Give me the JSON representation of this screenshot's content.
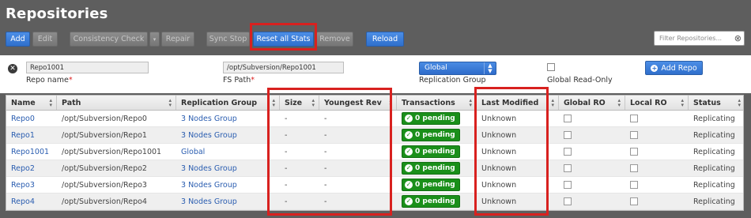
{
  "page": {
    "title": "Repositories"
  },
  "toolbar": {
    "add": "Add",
    "edit": "Edit",
    "consistency_check": "Consistency Check",
    "repair": "Repair",
    "sync_stop": "Sync Stop",
    "reset_all_stats": "Reset all Stats",
    "remove": "Remove",
    "reload": "Reload",
    "search_placeholder": "Filter Repositories...",
    "search_clear": "⊗"
  },
  "form": {
    "repo_name_value": "Repo1001",
    "repo_name_label": "Repo name",
    "fs_path_value": "/opt/Subversion/Repo1001",
    "fs_path_label": "FS Path",
    "required_mark": "*",
    "replication_group_value": "Global",
    "replication_group_label": "Replication Group",
    "global_readonly_label": "Global Read-Only",
    "add_repo": "Add Repo",
    "close_glyph": "✕"
  },
  "table": {
    "columns": [
      "Name",
      "Path",
      "Replication Group",
      "Size",
      "Youngest Rev",
      "Transactions",
      "Last Modified",
      "Global RO",
      "Local RO",
      "Status"
    ],
    "rows": [
      {
        "name": "Repo0",
        "path": "/opt/Subversion/Repo0",
        "group": "3 Nodes Group",
        "size": "-",
        "youngest": "-",
        "transactions": "0 pending",
        "last_modified": "Unknown",
        "status": "Replicating"
      },
      {
        "name": "Repo1",
        "path": "/opt/Subversion/Repo1",
        "group": "3 Nodes Group",
        "size": "-",
        "youngest": "-",
        "transactions": "0 pending",
        "last_modified": "Unknown",
        "status": "Replicating"
      },
      {
        "name": "Repo1001",
        "path": "/opt/Subversion/Repo1001",
        "group": "Global",
        "size": "-",
        "youngest": "-",
        "transactions": "0 pending",
        "last_modified": "Unknown",
        "status": "Replicating"
      },
      {
        "name": "Repo2",
        "path": "/opt/Subversion/Repo2",
        "group": "3 Nodes Group",
        "size": "-",
        "youngest": "-",
        "transactions": "0 pending",
        "last_modified": "Unknown",
        "status": "Replicating"
      },
      {
        "name": "Repo3",
        "path": "/opt/Subversion/Repo3",
        "group": "3 Nodes Group",
        "size": "-",
        "youngest": "-",
        "transactions": "0 pending",
        "last_modified": "Unknown",
        "status": "Replicating"
      },
      {
        "name": "Repo4",
        "path": "/opt/Subversion/Repo4",
        "group": "3 Nodes Group",
        "size": "-",
        "youngest": "-",
        "transactions": "0 pending",
        "last_modified": "Unknown",
        "status": "Replicating"
      }
    ]
  },
  "colors": {
    "accent": "#2f6fcc",
    "highlight": "#d8211f",
    "success": "#1a8f1a",
    "header_bg": "#5e5e5e"
  },
  "icons": {
    "close": "close-circle-icon",
    "sort": "sort-arrows-icon",
    "check": "check-circle-icon",
    "plus": "plus-circle-icon"
  }
}
